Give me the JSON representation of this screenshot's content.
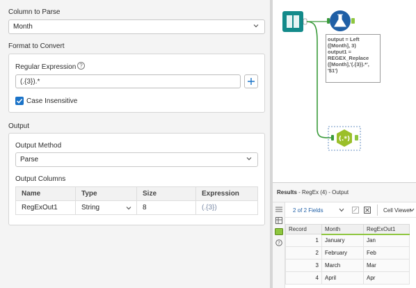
{
  "config": {
    "column_to_parse_label": "Column to Parse",
    "column_to_parse_value": "Month",
    "format_to_convert_label": "Format to Convert",
    "regex_label": "Regular Expression",
    "regex_value": "(.{3}).*",
    "plus_symbol": "+",
    "help_symbol": "?",
    "case_insensitive_label": "Case Insensitive",
    "case_insensitive_checked": true,
    "output_section_label": "Output",
    "output_method_label": "Output Method",
    "output_method_value": "Parse",
    "output_columns_label": "Output Columns",
    "columns_headers": [
      "Name",
      "Type",
      "Size",
      "Expression"
    ],
    "columns_rows": [
      {
        "name": "RegExOut1",
        "type": "String",
        "size": "8",
        "expression": "(.{3})"
      }
    ]
  },
  "canvas": {
    "annotation_lines": [
      "output = Left",
      "([Month], 3)",
      "output1 =",
      "REGEX_Replace",
      "([Month],'(.{3}).*',",
      "'$1')"
    ],
    "accent_green": "#3a9b3a",
    "tool_teal": "#138a8a",
    "tool_blue": "#1f5fa6",
    "regex_tool_green": "#9bbf2a"
  },
  "results": {
    "title_prefix": "Results",
    "title_suffix": " - RegEx (4) - Output",
    "fields_label": "2 of 2 Fields",
    "cell_viewer_label": "Cell Viewer",
    "headers": [
      "Record",
      "Month",
      "RegExOut1"
    ],
    "rows": [
      {
        "record": "1",
        "month": "January",
        "out": "Jan"
      },
      {
        "record": "2",
        "month": "February",
        "out": "Feb"
      },
      {
        "record": "3",
        "month": "March",
        "out": "Mar"
      },
      {
        "record": "4",
        "month": "April",
        "out": "Apr"
      }
    ]
  }
}
